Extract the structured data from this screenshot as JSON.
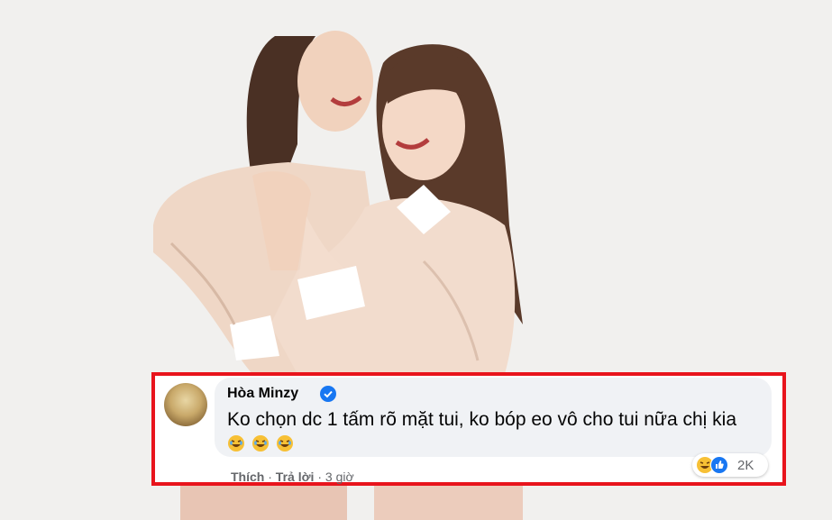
{
  "comment": {
    "author": "Hòa Minzy",
    "text": "Ko chọn dc 1 tấm rõ mặt tui, ko bóp eo vô cho tui nữa chị kia",
    "emoji": [
      "laughing-face",
      "laughing-face",
      "laughing-face"
    ],
    "reaction_count": "2K",
    "reactions": [
      "haha",
      "like"
    ],
    "actions": {
      "like": "Thích",
      "separator": "·",
      "reply": "Trả lời",
      "time": "3 giờ"
    }
  },
  "colors": {
    "highlight_border": "#e8141c",
    "bubble": "#f0f2f5",
    "verified": "#1877f2",
    "meta_text": "#65676b"
  }
}
